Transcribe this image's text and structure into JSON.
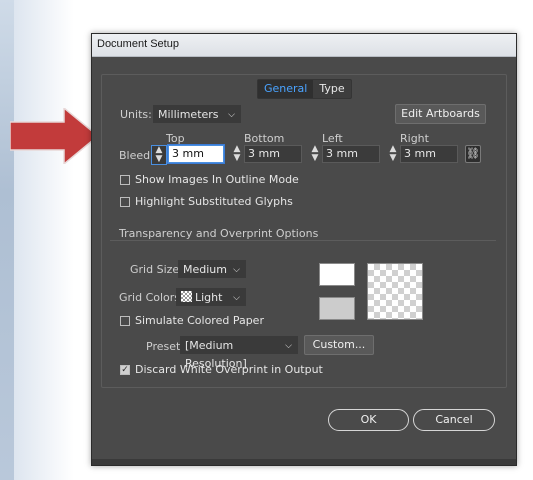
{
  "window": {
    "title": "Document Setup"
  },
  "tabs": [
    {
      "label": "General",
      "active": true
    },
    {
      "label": "Type",
      "active": false
    }
  ],
  "units": {
    "label": "Units:",
    "value": "Millimeters"
  },
  "edit_artboards_label": "Edit Artboards",
  "bleed": {
    "label": "Bleed:",
    "columns": [
      "Top",
      "Bottom",
      "Left",
      "Right"
    ],
    "values": [
      "3 mm",
      "3 mm",
      "3 mm",
      "3 mm"
    ],
    "link_icon": "chain-link-icon"
  },
  "options": {
    "show_images_outline": {
      "label": "Show Images In Outline Mode",
      "checked": false
    },
    "highlight_glyphs": {
      "label": "Highlight Substituted Glyphs",
      "checked": false
    }
  },
  "transparency": {
    "section_title": "Transparency and Overprint Options",
    "grid_size": {
      "label": "Grid Size:",
      "value": "Medium"
    },
    "grid_colors": {
      "label": "Grid Colors:",
      "value": "Light"
    },
    "simulate_paper": {
      "label": "Simulate Colored Paper",
      "checked": false
    },
    "preset": {
      "label": "Preset:",
      "value": "[Medium Resolution]"
    },
    "custom_label": "Custom...",
    "discard_white": {
      "label": "Discard White Overprint in Output",
      "checked": true
    },
    "swatch_colors": {
      "top": "#ffffff",
      "bottom": "#cccccc"
    }
  },
  "footer": {
    "ok_label": "OK",
    "cancel_label": "Cancel"
  },
  "annotation_arrow": {
    "color": "#c23b3b"
  }
}
